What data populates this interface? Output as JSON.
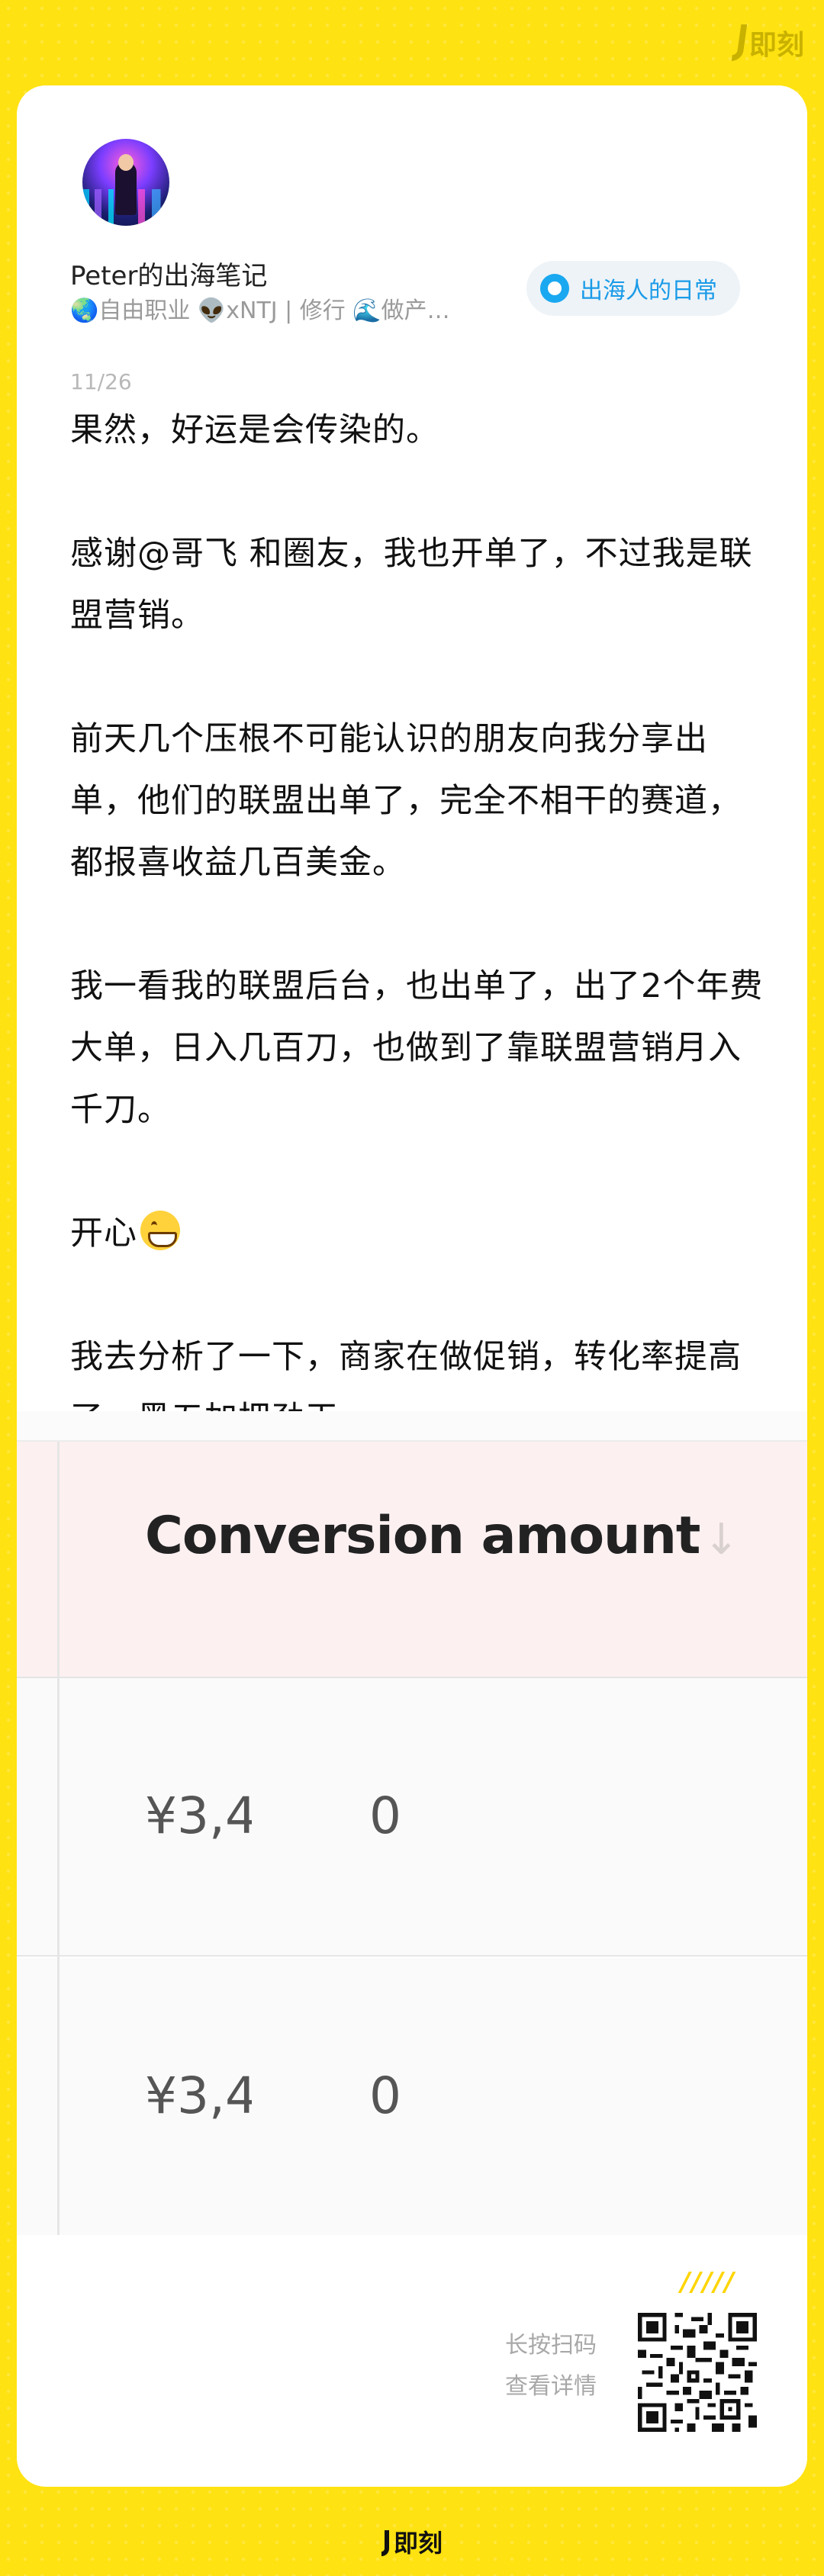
{
  "brand": {
    "name": "即刻",
    "accent": "#FFE211"
  },
  "author": {
    "name": "Peter的出海笔记",
    "tags": "🌏自由职业 👽xNTJ | 修行 🌊做产…"
  },
  "circle": {
    "label": "出海人的日常",
    "icon": "circle-dot-icon"
  },
  "post": {
    "date": "11/26",
    "paragraphs": [
      "果然，好运是会传染的。",
      "感谢@哥飞 和圈友，我也开单了，不过我是联盟营销。",
      "前天几个压根不可能认识的朋友向我分享出单，他们的联盟出单了，完全不相干的赛道，都报喜收益几百美金。",
      "我一看我的联盟后台，也出单了，出了2个年费大单，日入几百刀，也做到了靠联盟营销月入千刀。",
      "开心",
      "我去分析了一下，商家在做促销，转化率提高了。黑五加把劲干。"
    ],
    "emoji": "grin-emoji"
  },
  "screenshot": {
    "column_header": "Conversion amount",
    "sort_icon": "arrow-down-icon",
    "rows": [
      {
        "amount": "¥3,4",
        "value": "0"
      },
      {
        "amount": "¥3,4",
        "value": "0"
      }
    ]
  },
  "footer": {
    "stripes": "/////",
    "scan_line1": "长按扫码",
    "scan_line2": "查看详情",
    "qr": "qr-code-icon"
  }
}
